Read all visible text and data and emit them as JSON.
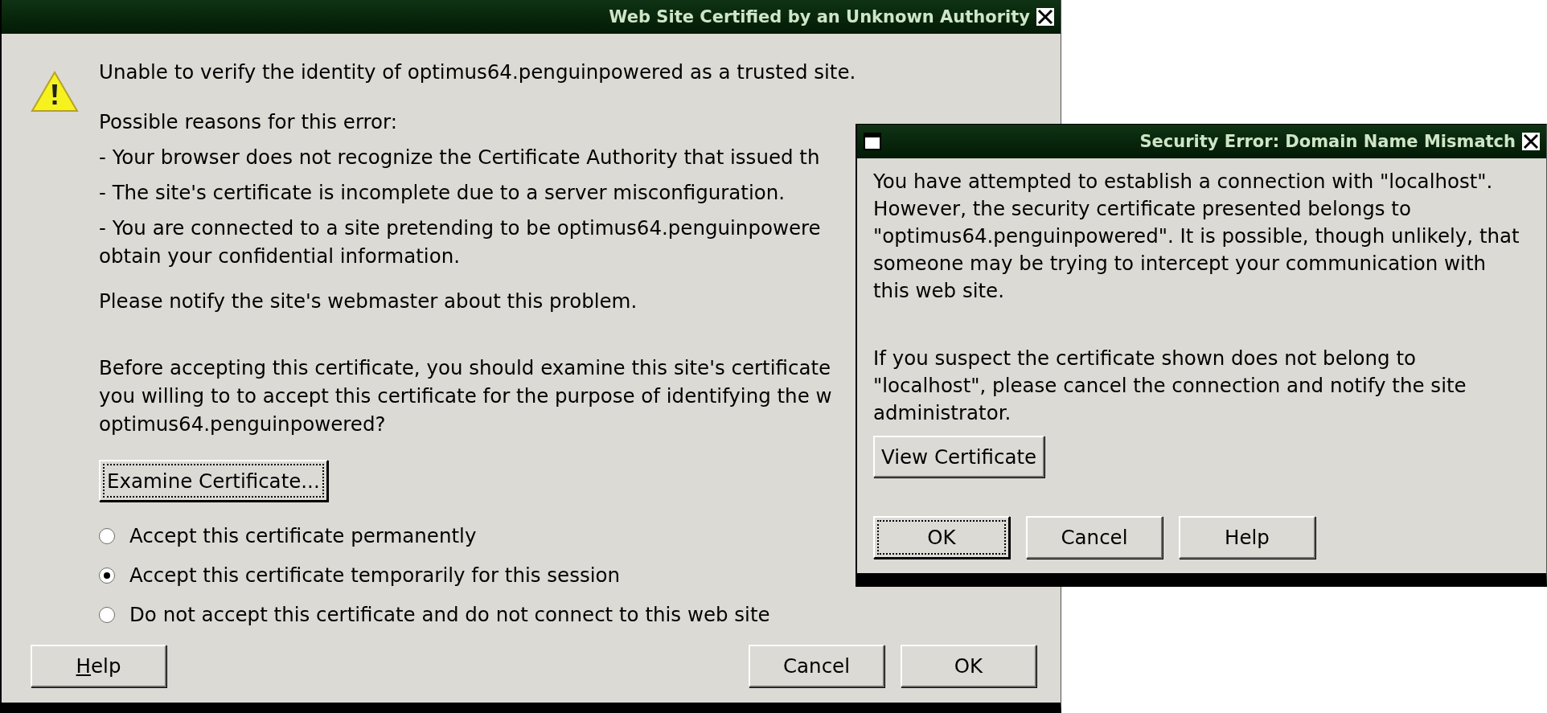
{
  "certificate_dialog": {
    "title": "Web Site Certified by an Unknown Authority",
    "message": "Unable to verify the identity of optimus64.penguinpowered as a trusted site.",
    "reasons_heading": "Possible reasons for this error:",
    "reasons": [
      [
        "- Your browser does not recognize the Certificate Authority that issued th"
      ],
      [
        "- The site's certificate is incomplete due to a server misconfiguration."
      ],
      [
        "- You are connected to a site pretending to be optimus64.penguinpowere",
        "obtain your confidential information."
      ]
    ],
    "notice": "Please notify the site's webmaster about this problem.",
    "question_lines": [
      "Before accepting this certificate, you should examine this site's certificate",
      "you willing to to accept this certificate for the purpose of identifying the w",
      "optimus64.penguinpowered?"
    ],
    "examine_button": {
      "label": "Examine Certificate...",
      "focused": true
    },
    "options": [
      {
        "label": "Accept this certificate permanently",
        "selected": false
      },
      {
        "label": "Accept this certificate temporarily for this session",
        "selected": true
      },
      {
        "label": "Do not accept this certificate and do not connect to this web site",
        "selected": false
      }
    ],
    "left_buttons": [
      {
        "label": "Help",
        "underline_first": true,
        "focused": false
      }
    ],
    "right_buttons": [
      {
        "label": "Cancel",
        "underline_first": false,
        "focused": false
      },
      {
        "label": "OK",
        "underline_first": false,
        "focused": false
      }
    ]
  },
  "mismatch_dialog": {
    "title": "Security Error: Domain Name Mismatch",
    "paragraphs": [
      [
        "You have attempted to establish a connection with \"localhost\".",
        "However, the security certificate presented belongs to",
        "\"optimus64.penguinpowered\". It is possible, though unlikely, that",
        "someone may be trying to intercept your communication with",
        "this web site."
      ],
      [
        "If you suspect the certificate shown does not belong to",
        "\"localhost\", please cancel the connection and notify the site",
        "administrator."
      ]
    ],
    "view_button": {
      "label": "View Certificate",
      "focused": false
    },
    "buttons": [
      {
        "label": "OK",
        "focused": true
      },
      {
        "label": "Cancel",
        "focused": false
      },
      {
        "label": "Help",
        "focused": false
      }
    ]
  }
}
